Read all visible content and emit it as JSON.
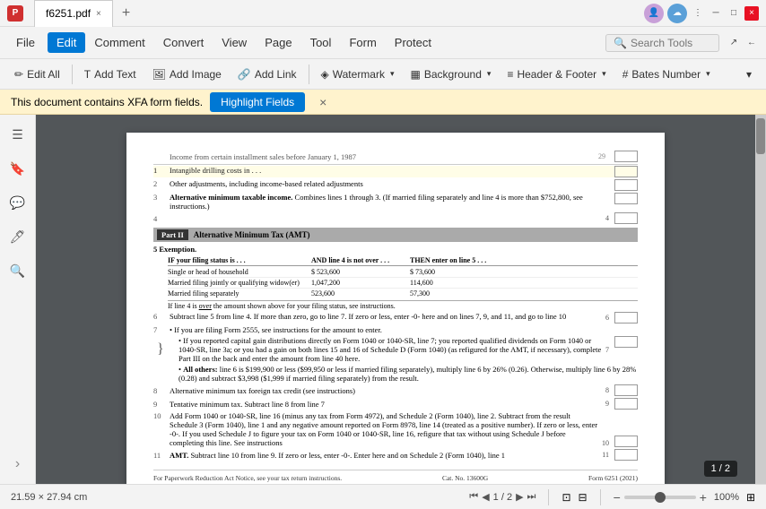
{
  "titlebar": {
    "app_icon": "P",
    "filename": "f6251.pdf",
    "close_tab": "×",
    "add_tab": "+",
    "profile_icon": "👤",
    "cloud_icon": "☁",
    "menu_icon": "⋮",
    "minimize": "─",
    "maximize": "□",
    "close": "×"
  },
  "menubar": {
    "items": [
      "File",
      "Edit",
      "Comment",
      "Convert",
      "View",
      "Page",
      "Tool",
      "Form",
      "Protect"
    ],
    "active_item": "Edit",
    "search_placeholder": "Search Tools"
  },
  "toolbar": {
    "edit_all": "Edit All",
    "edit_all_icon": "✏",
    "add_text": "Add Text",
    "add_text_icon": "T",
    "add_image": "Add Image",
    "add_image_icon": "🖼",
    "add_link": "Add Link",
    "add_link_icon": "🔗",
    "watermark": "Watermark",
    "watermark_icon": "◈",
    "background": "Background",
    "background_icon": "▦",
    "header_footer": "Header & Footer",
    "header_footer_icon": "≡",
    "bates_number": "Bates Number",
    "bates_number_icon": "#"
  },
  "notification": {
    "text": "This document contains XFA form fields.",
    "button": "Highlight Fields",
    "close": "×"
  },
  "pdf": {
    "page_info": "1 / 2",
    "zoom": "100%",
    "page_size": "21.59 × 27.94 cm",
    "rows": [
      {
        "num": "",
        "content": "Income from certain installment sales before January 1, 1987",
        "col_val": "29"
      },
      {
        "num": "1",
        "content": "Intangible drilling costs in . . . . . . . . . . . . . . .",
        "col_val": ""
      },
      {
        "num": "2",
        "content": "Other adjustments, including income-based related adjustments",
        "col_val": ""
      },
      {
        "num": "3",
        "content": "Alternative minimum taxable income. Combines lines 1 through 3. (If married filing separately and line 4 is more than $752,800, see instructions.)",
        "col_val": "4",
        "bold_start": "Alternative minimum taxable income."
      },
      {
        "num": "4",
        "content": ""
      }
    ],
    "part2_title": "Alternative Minimum Tax (AMT)",
    "part2_label": "Part II",
    "exemption_label": "5   Exemption.",
    "table_headers": [
      "IF your filing status is . . .",
      "AND line 4 is not over . . .",
      "THEN enter on line 5 . . ."
    ],
    "table_rows": [
      {
        "col1": "Single or head of household",
        "col2": "$ 523,600",
        "col3": "$ 73,600"
      },
      {
        "col1": "Married filing jointly or qualifying widow(er)",
        "col2": "1,047,200",
        "col3": "114,600"
      },
      {
        "col1": "Married filing separately",
        "col2": "523,600",
        "col3": "57,300"
      }
    ],
    "table_note": "If line 4 is over the amount shown above for your filing status, see instructions.",
    "rows2": [
      {
        "num": "6",
        "content": "Subtract line 5 from line 4. If more than zero, go to line 7. If zero or less, enter -0- here and on lines 7, 9, and 11, and go to line 10",
        "col_val": "6"
      },
      {
        "num": "7",
        "content": "• If you are filing Form 2555, see instructions for the amount to enter.",
        "col_val": ""
      },
      {
        "num": "",
        "sub": "• If you reported capital gain distributions directly on Form 1040 or 1040-SR, line 7; you reported qualified dividends on Form 1040 or 1040-SR, line 3a; or you had a gain on both lines 15 and 16 of Schedule D (Form 1040) (as refigured for the AMT, if necessary), complete Part III on the back and enter the amount from line 40 here.",
        "col_val": "7"
      },
      {
        "num": "",
        "sub": "• All others: line 6 is $199,900 or less ($99,950 or less if married filing separately), multiply line 6 by 26% (0.26). Otherwise, multiply line 6 by 28% (0.28) and subtract $3,998 ($1,999 if married filing separately) from the result.",
        "col_val": ""
      },
      {
        "num": "8",
        "content": "Alternative minimum tax foreign tax credit (see instructions)",
        "col_val": "8"
      },
      {
        "num": "9",
        "content": "Tentative minimum tax. Subtract line 8 from line 7",
        "col_val": "9"
      },
      {
        "num": "10",
        "content": "Add Form 1040 or 1040-SR, line 16 (minus any tax from Form 4972), and Schedule 2 (Form 1040), line 2. Subtract from the result Schedule 3 (Form 1040), line 1 and any negative amount reported on Form 8978, line 14 (treated as a positive number). If zero or less, enter -0-. If you used Schedule J to figure your tax on Form 1040 or 1040-SR, line 16, refigure that tax without using Schedule J before completing this line. See instructions",
        "col_val": "10"
      },
      {
        "num": "11",
        "content": "AMT. Subtract line 10 from line 9. If zero or less, enter -0-. Enter here and on Schedule 2 (Form 1040), line 1",
        "col_val": "11",
        "bold_start": "AMT."
      }
    ],
    "paperwork_note": "For Paperwork Reduction Act Notice, see your tax return instructions.",
    "cat_no": "Cat. No. 13600G",
    "form_label": "Form 6251 (2021)"
  },
  "sidebar": {
    "icons": [
      "☰",
      "🔖",
      "💬",
      "🖊",
      "🔍"
    ]
  },
  "bottom": {
    "page_size": "21.59 × 27.94 cm",
    "nav_first": "⏮",
    "nav_prev": "◀",
    "nav_page": "1 / 2",
    "nav_next": "▶",
    "nav_last": "⏭",
    "fit_page": "⊡",
    "fit_width": "⊟",
    "rotate": "⟳",
    "zoom_out": "−",
    "zoom_level": "100%",
    "zoom_in": "+",
    "zoom_fit": "⊞"
  }
}
